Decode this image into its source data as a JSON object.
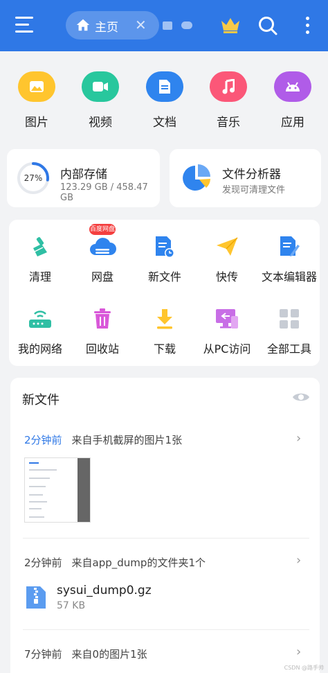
{
  "header": {
    "tab_label": "主页",
    "colors": {
      "bar": "#2f78e6"
    }
  },
  "categories": [
    {
      "label": "图片",
      "icon": "image-icon",
      "color": "#ffc52e"
    },
    {
      "label": "视频",
      "icon": "video-icon",
      "color": "#28c79d"
    },
    {
      "label": "文档",
      "icon": "document-icon",
      "color": "#2f84ee"
    },
    {
      "label": "音乐",
      "icon": "music-icon",
      "color": "#fb5778"
    },
    {
      "label": "应用",
      "icon": "android-icon",
      "color": "#b05ce8"
    }
  ],
  "storage": {
    "title": "内部存储",
    "used": "123.29 GB / 458.47 GB",
    "percent_label": "27%",
    "percent": 27
  },
  "analyzer": {
    "title": "文件分析器",
    "subtitle": "发现可清理文件"
  },
  "tools": [
    {
      "label": "清理",
      "icon": "broom-icon"
    },
    {
      "label": "网盘",
      "icon": "cloud-disk-icon",
      "badge": "百度网盘"
    },
    {
      "label": "新文件",
      "icon": "new-file-icon"
    },
    {
      "label": "快传",
      "icon": "send-icon"
    },
    {
      "label": "文本编辑器",
      "icon": "text-editor-icon"
    },
    {
      "label": "我的网络",
      "icon": "router-icon"
    },
    {
      "label": "回收站",
      "icon": "trash-icon"
    },
    {
      "label": "下载",
      "icon": "download-icon"
    },
    {
      "label": "从PC访问",
      "icon": "pc-access-icon"
    },
    {
      "label": "全部工具",
      "icon": "all-tools-icon"
    }
  ],
  "new_files": {
    "title": "新文件",
    "groups": [
      {
        "time": "2分钟前",
        "desc": "来自手机截屏的图片1张"
      },
      {
        "time": "2分钟前",
        "desc": "来自app_dump的文件夹1个"
      },
      {
        "time": "7分钟前",
        "desc": "来自0的图片1张"
      }
    ],
    "file": {
      "name": "sysui_dump0.gz",
      "size": "57 KB"
    }
  },
  "watermark": "CSDN @路手帅"
}
